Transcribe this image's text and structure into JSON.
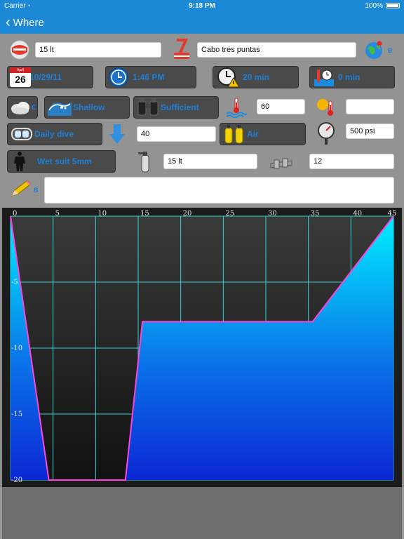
{
  "status": {
    "carrier": "Carrier",
    "time": "9:18 PM",
    "battery": "100%"
  },
  "nav": {
    "back_label": "Where"
  },
  "row1": {
    "tank_volume": "15 lt",
    "site": "Cabo tres puntas",
    "globe_badge": "B"
  },
  "row2": {
    "date": "10/29/11",
    "calendar_month": "April",
    "calendar_day": "26",
    "time": "1:46 PM",
    "duration": "20 min",
    "surface_interval": "0 min"
  },
  "row3": {
    "weather_badge": "E",
    "entry_type": "Shallow",
    "visibility": "Sufficient",
    "water_temp": "60",
    "air_temp": ""
  },
  "row4": {
    "dive_type": "Daily dive",
    "max_depth": "40",
    "gas": "Air",
    "pressure": "500 psi"
  },
  "row5": {
    "suit": "Wet suit 5mm",
    "tank_size": "15 lt",
    "weight": "12"
  },
  "notes": {
    "badge": "B",
    "text": ""
  },
  "colors": {
    "accent": "#1c89d6",
    "label_blue": "#1d7fd8",
    "profile_line": "#ff44dd",
    "grid": "#2fd6d6"
  },
  "chart_data": {
    "type": "area",
    "x": [
      0,
      4.5,
      13.5,
      15.5,
      35.5,
      45
    ],
    "y": [
      0,
      -20,
      -20,
      -8,
      -8,
      0
    ],
    "xticks": [
      0,
      5,
      10,
      15,
      20,
      25,
      30,
      35,
      40,
      45
    ],
    "yticks": [
      -5,
      -10,
      -15,
      -20
    ],
    "xlim": [
      0,
      45
    ],
    "ylim": [
      -20,
      0
    ],
    "grid": true
  }
}
